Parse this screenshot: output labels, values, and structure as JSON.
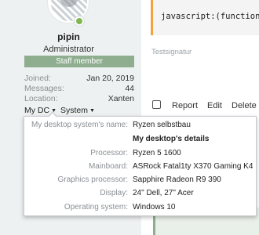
{
  "profile": {
    "name": "pipin",
    "role": "Administrator",
    "badge": "Staff member",
    "stats": [
      {
        "label": "Joined:",
        "value": "Jan 20, 2019"
      },
      {
        "label": "Messages:",
        "value": "44"
      },
      {
        "label": "Location:",
        "value": "Xanten"
      }
    ],
    "dropdowns": [
      {
        "label": "My DC"
      },
      {
        "label": "System"
      }
    ]
  },
  "post": {
    "code": "javascript:(function",
    "signature": "Testsignatur",
    "actions": [
      "Report",
      "Edit",
      "Delete"
    ]
  },
  "tooltip": {
    "system_name": {
      "label": "My desktop system's name:",
      "value": "Ryzen selbstbau"
    },
    "heading": "My desktop's details",
    "details": [
      {
        "label": "Processor:",
        "value": "Ryzen 5 1600"
      },
      {
        "label": "Mainboard:",
        "value": "ASRock Fatal1ty X370 Gaming K4"
      },
      {
        "label": "Graphics processor:",
        "value": "Sapphire Radeon R9 390"
      },
      {
        "label": "Display:",
        "value": "24\" Dell, 27\" Acer"
      },
      {
        "label": "Operating system:",
        "value": "Windows 10"
      }
    ]
  },
  "colors": {
    "badge": "#8eae8f",
    "online": "#7fb84f",
    "code_accent": "#f2a23a",
    "sidebar_bg": "#eef1f1"
  },
  "icons": {
    "online_status": "online-dot-icon",
    "dropdown": "caret-down-icon",
    "select": "checkbox"
  }
}
